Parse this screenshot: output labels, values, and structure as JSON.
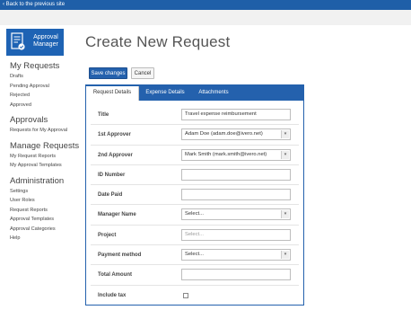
{
  "topbar": {
    "back_link": "‹ Back to the previous site"
  },
  "logo": {
    "line1": "Approval",
    "line2": "Manager",
    "icon": "document-check-icon"
  },
  "sidebar": {
    "sections": [
      {
        "title": "My Requests",
        "items": [
          "Drafts",
          "Pending Approval",
          "Rejected",
          "Approved"
        ]
      },
      {
        "title": "Approvals",
        "items": [
          "Requests for My Approval"
        ]
      },
      {
        "title": "Manage Requests",
        "items": [
          "My Request Reports",
          "My Approval Templates"
        ]
      },
      {
        "title": "Administration",
        "items": [
          "Settings",
          "User Roles",
          "Request Reports",
          "Approval Templates",
          "Approval Categories",
          "Help"
        ]
      }
    ]
  },
  "page": {
    "title": "Create New Request"
  },
  "toolbar": {
    "save_label": "Save changes",
    "cancel_label": "Cancel"
  },
  "tabs": [
    "Request Details",
    "Expense Details",
    "Attachments"
  ],
  "form": {
    "title_label": "Title",
    "title_value": "Travel expense reimbursement",
    "approver1_label": "1st Approver",
    "approver1_value": "Adam Doe (adam.doe@ivero.net)",
    "approver2_label": "2nd Approver",
    "approver2_value": "Mark Smith (mark.smith@ivero.net)",
    "id_label": "ID Number",
    "date_label": "Date Paid",
    "manager_label": "Manager Name",
    "manager_value": "Select...",
    "project_label": "Project",
    "project_placeholder": "Select...",
    "payment_label": "Payment method",
    "payment_value": "Select...",
    "amount_label": "Total Amount",
    "tax_label": "Include tax"
  }
}
